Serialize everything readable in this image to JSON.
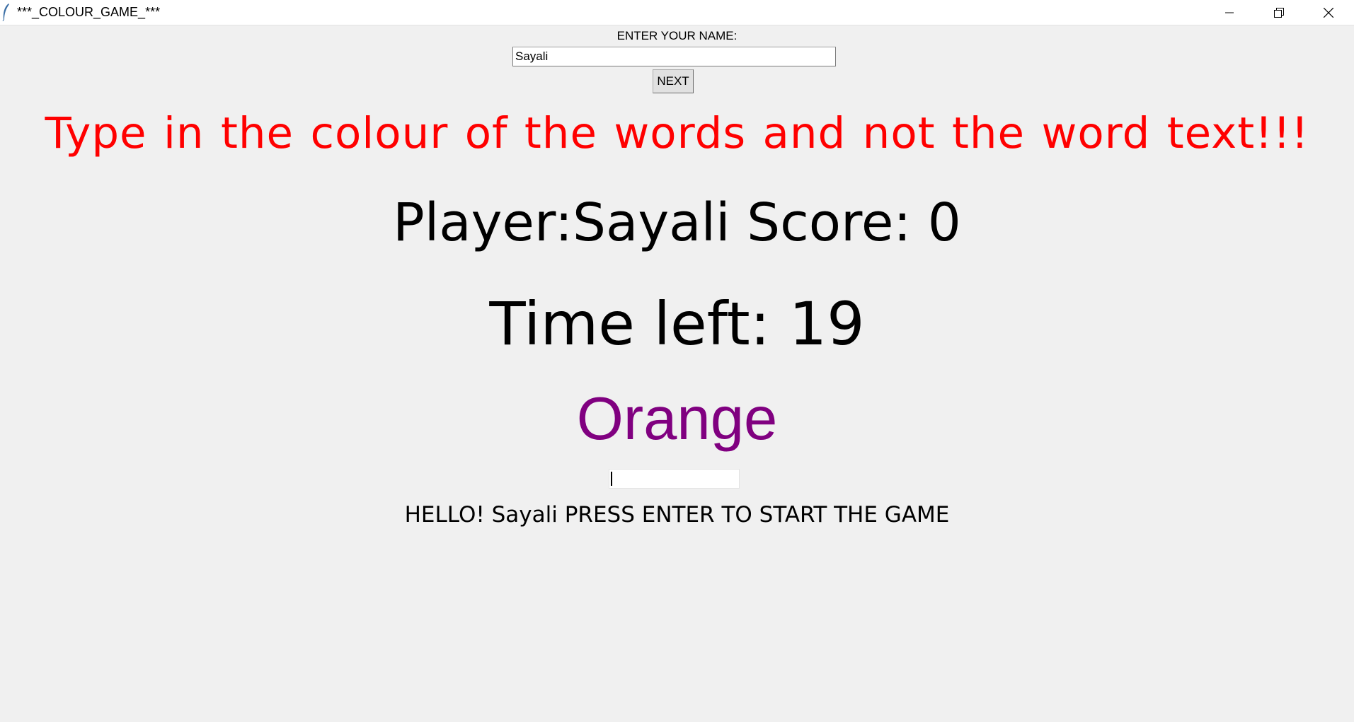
{
  "window": {
    "title": "***_COLOUR_GAME_***",
    "controls": {
      "minimize_icon": "minimize-icon",
      "maximize_icon": "restore-icon",
      "close_icon": "close-icon"
    }
  },
  "name_section": {
    "label": "ENTER YOUR NAME:",
    "value": "Sayali",
    "next_label": "NEXT"
  },
  "game": {
    "instructions": "Type in the colour of the words and not the word text!!!",
    "player_score": "Player:Sayali  Score: 0",
    "time_left": "Time left: 19",
    "color_word": "Orange",
    "color_word_fill": "#800080",
    "answer_value": "",
    "status_message": "HELLO! Sayali PRESS ENTER TO START THE GAME"
  },
  "colors": {
    "instructions_text": "#ff0000",
    "background": "#f0f0f0"
  }
}
